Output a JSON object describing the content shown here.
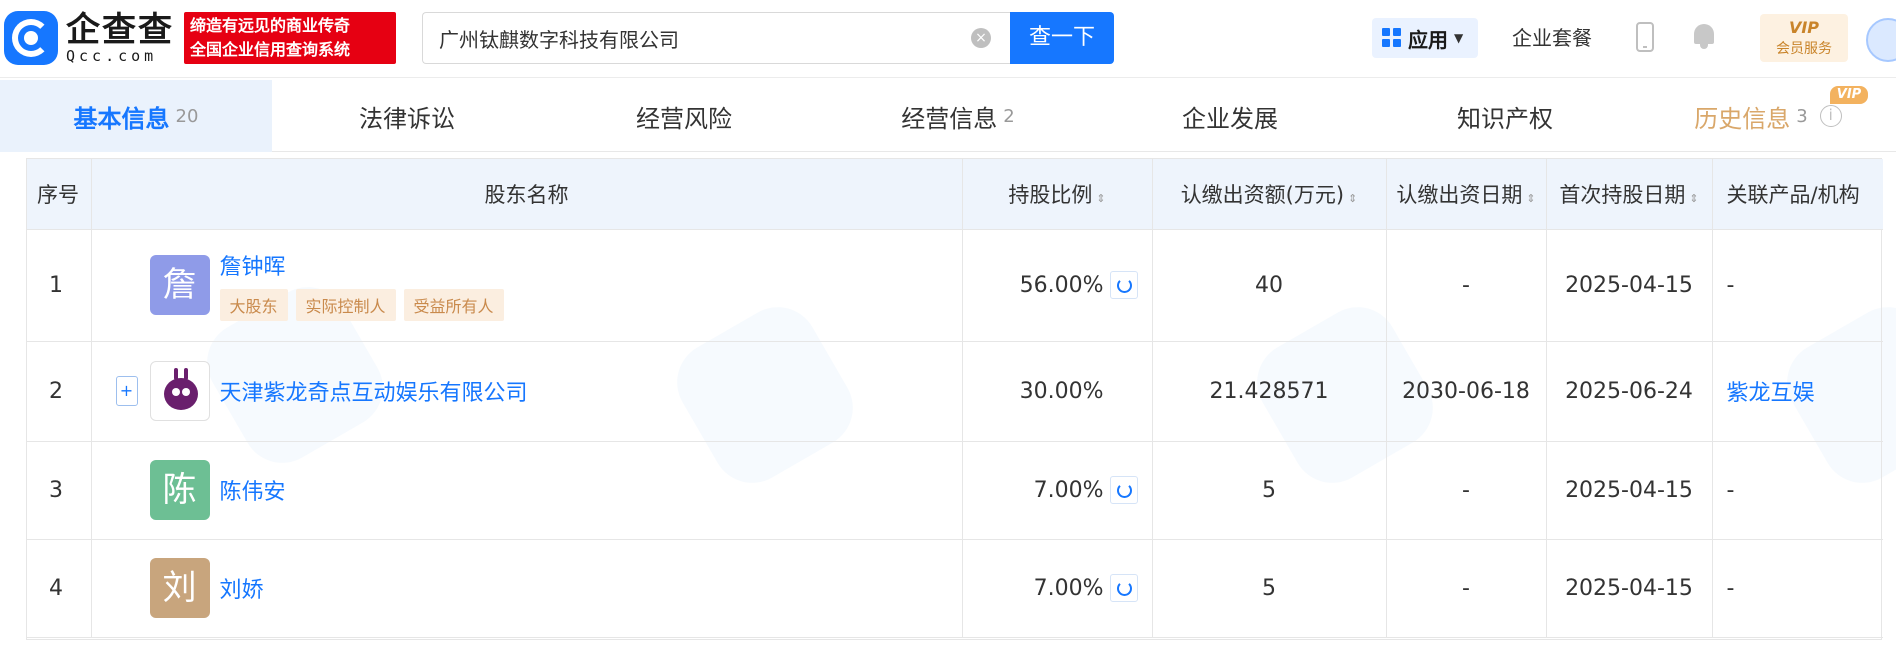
{
  "header": {
    "logo_name": "企查查",
    "logo_domain": "Qcc.com",
    "slogan_line1": "缔造有远见的商业传奇",
    "slogan_line2": "全国企业信用查询系统",
    "search_value": "广州钛麒数字科技有限公司",
    "search_button": "查一下",
    "apps_label": "应用",
    "package_link": "企业套餐",
    "vip_top": "VIP",
    "vip_bottom": "会员服务"
  },
  "tabs": [
    {
      "label": "基本信息",
      "count": "20"
    },
    {
      "label": "法律诉讼",
      "count": ""
    },
    {
      "label": "经营风险",
      "count": ""
    },
    {
      "label": "经营信息",
      "count": "2"
    },
    {
      "label": "企业发展",
      "count": ""
    },
    {
      "label": "知识产权",
      "count": ""
    },
    {
      "label": "历史信息",
      "count": "3"
    }
  ],
  "vip_tag": "VIP",
  "table": {
    "columns": [
      "序号",
      "股东名称",
      "持股比例",
      "认缴出资额(万元)",
      "认缴出资日期",
      "首次持股日期",
      "关联产品/机构"
    ],
    "rows": [
      {
        "index": "1",
        "avatar_char": "詹",
        "avatar_color": "#8f9be8",
        "name": "詹钟晖",
        "tags": [
          "大股东",
          "实际控制人",
          "受益所有人"
        ],
        "ratio": "56.00%",
        "amount": "40",
        "pay_date": "-",
        "first_date": "2025-04-15",
        "product": "-"
      },
      {
        "index": "2",
        "avatar_char": "",
        "avatar_color": "",
        "name": "天津紫龙奇点互动娱乐有限公司",
        "tags": [],
        "ratio": "30.00%",
        "amount": "21.428571",
        "pay_date": "2030-06-18",
        "first_date": "2025-06-24",
        "product": "紫龙互娱"
      },
      {
        "index": "3",
        "avatar_char": "陈",
        "avatar_color": "#6dbf94",
        "name": "陈伟安",
        "tags": [],
        "ratio": "7.00%",
        "amount": "5",
        "pay_date": "-",
        "first_date": "2025-04-15",
        "product": "-"
      },
      {
        "index": "4",
        "avatar_char": "刘",
        "avatar_color": "#c8a57d",
        "name": "刘娇",
        "tags": [],
        "ratio": "7.00%",
        "amount": "5",
        "pay_date": "-",
        "first_date": "2025-04-15",
        "product": "-"
      }
    ]
  }
}
